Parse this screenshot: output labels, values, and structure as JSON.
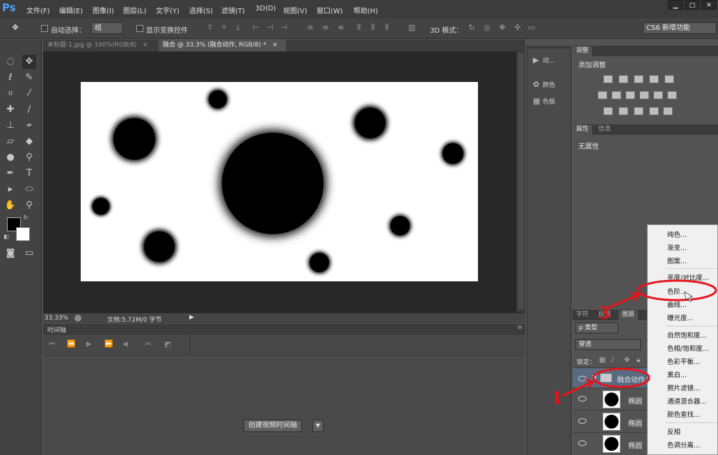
{
  "app": {
    "logo": "Ps",
    "menus": [
      "文件(F)",
      "编辑(E)",
      "图像(I)",
      "图层(L)",
      "文字(Y)",
      "选择(S)",
      "滤镜(T)",
      "3D(D)",
      "视图(V)",
      "窗口(W)",
      "帮助(H)"
    ],
    "window_controls": [
      "▁",
      "□",
      "✕"
    ]
  },
  "options": {
    "auto_select_label": "自动选择：",
    "auto_select_value": "组",
    "show_transform_label": "显示变换控件",
    "mode_3d_label": "3D 模式：",
    "workspace": "CS6 新增功能"
  },
  "tabs": [
    {
      "label": "未标题-1.jpg @ 100%(RGB/8)",
      "close": "×"
    },
    {
      "label": "融合 @ 33.3% (融合动作, RGB/8) *",
      "close": "×"
    }
  ],
  "status": {
    "zoom": "33.33%",
    "doc_info": "文档:5.72M/0 字节"
  },
  "timeline": {
    "tab": "时间轴",
    "create_button": "创建视频时间轴"
  },
  "dock": [
    {
      "icon": "play-icon",
      "label": "动..."
    },
    {
      "icon": "palette-icon",
      "label": "颜色"
    },
    {
      "icon": "swatches-icon",
      "label": "色板"
    }
  ],
  "adjustments": {
    "tab": "调整",
    "title": "添加调整"
  },
  "properties": {
    "tabs": [
      "属性",
      "信息"
    ],
    "empty": "无属性"
  },
  "layers": {
    "tabs": [
      "字符",
      "段落",
      "图层"
    ],
    "filter": "ρ 类型",
    "blend_mode": "穿透",
    "lock_label": "锁定：",
    "group_name": "融合动作",
    "items": [
      "椭圆",
      "椭圆",
      "椭圆"
    ]
  },
  "context_menu": {
    "group1": [
      "纯色...",
      "渐变...",
      "图案..."
    ],
    "group2": [
      "亮度/对比度...",
      "色阶...",
      "曲线...",
      "曝光度..."
    ],
    "group3": [
      "自然饱和度...",
      "色相/饱和度...",
      "色彩平衡...",
      "黑白...",
      "照片滤镜...",
      "通道混合器...",
      "颜色查找..."
    ],
    "group4": [
      "反相",
      "色调分离..."
    ]
  },
  "annotations": {
    "step1": "1",
    "step3": "3",
    "color": "#e8141b"
  }
}
